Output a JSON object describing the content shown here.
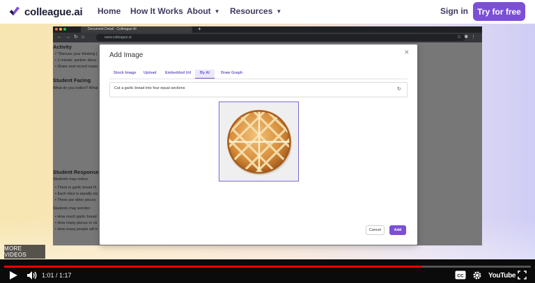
{
  "site": {
    "brand": "colleague.ai",
    "nav": {
      "home": "Home",
      "how_it_works": "How It Works",
      "about": "About",
      "resources": "Resources"
    },
    "sign_in": "Sign in",
    "cta": "Try for free",
    "accent": "#7b4fd6"
  },
  "browser": {
    "tab_title": "Document Detail - Colleague AI",
    "url": "www.colleague.ai"
  },
  "document": {
    "lines_top": [
      {
        "kind": "head",
        "text": "Activity"
      },
      {
        "kind": "text",
        "text": "\"Discuss your thinking ("
      },
      {
        "kind": "text",
        "text": "1 minute: partner discu"
      },
      {
        "kind": "text",
        "text": "Share and record respo"
      }
    ],
    "student_facing": "Student Facing",
    "student_facing_q": "What do you notice? What",
    "student_response": "Student Response",
    "may_notice": "Students may notice:",
    "notice_items": [
      "There is garlic bread th",
      "Each slice is equally siz",
      "There are other pieces"
    ],
    "may_wonder": "Students may wonder:",
    "wonder_items": [
      "How much garlic bread",
      "How many pieces or sli",
      "How many people will b"
    ]
  },
  "modal": {
    "title": "Add Image",
    "tabs": [
      "Stock Image",
      "Upload",
      "Embedded Url",
      "By AI",
      "Draw Graph"
    ],
    "active_tab": "By AI",
    "prompt_value": "Cut a garlic bread into four equal sections",
    "cancel": "Cancel",
    "add": "Add"
  },
  "overlay": {
    "more_videos": "MORE VIDEOS"
  },
  "player": {
    "current_time": "1:01",
    "duration": "1:17",
    "time_display": "1:01 / 1:17",
    "progress_fraction": 0.793,
    "youtube_label": "YouTube",
    "icons": [
      "play-icon",
      "volume-icon",
      "captions-icon",
      "settings-icon",
      "fullscreen-icon"
    ]
  }
}
